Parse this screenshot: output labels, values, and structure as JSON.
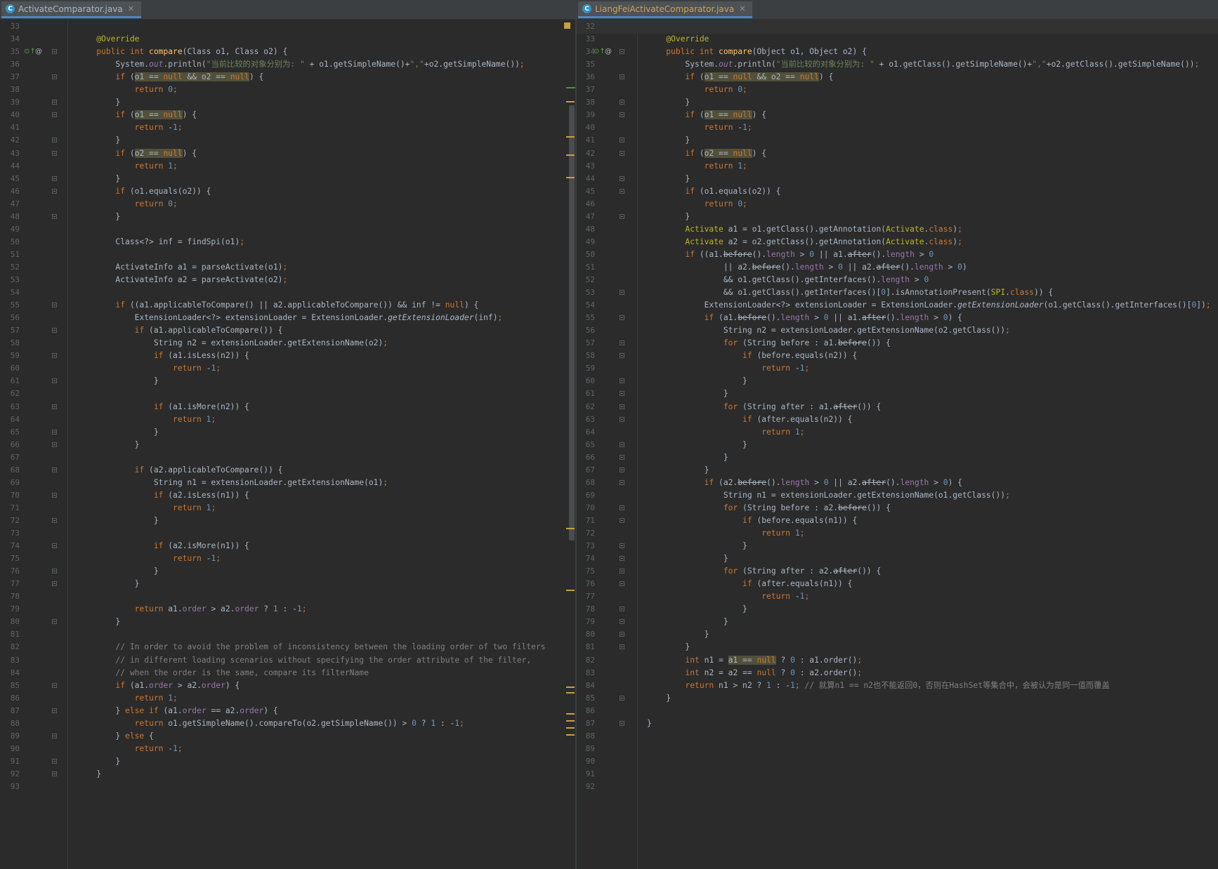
{
  "left": {
    "tab_title": "ActivateComparator.java",
    "tab_icon_letter": "C",
    "lines": [
      {
        "no": "33",
        "code": ""
      },
      {
        "no": "34",
        "code": "    <span class=\"a\">@Override</span>"
      },
      {
        "no": "35",
        "code": "    <span class=\"k\">public int </span><span class=\"f\">compare</span>(Class o1, Class o2) {",
        "gutter": "impl"
      },
      {
        "no": "36",
        "code": "        System.<span class=\"st\">out</span>.println(<span class=\"s\">\"当前比较的对象分别为: \"</span> + o1.getSimpleName()+<span class=\"s\">\",\"</span>+o2.getSimpleName())<span class=\"k\">;</span>"
      },
      {
        "no": "37",
        "code": "        <span class=\"k\">if </span>(<span class=\"hv\">o1 == <span class=\"k\">null</span> &amp;&amp; o2 == <span class=\"k\">null</span></span>) {"
      },
      {
        "no": "38",
        "code": "            <span class=\"k\">return </span><span class=\"n\">0</span><span class=\"k\">;</span>"
      },
      {
        "no": "39",
        "code": "        }"
      },
      {
        "no": "40",
        "code": "        <span class=\"k\">if </span>(<span class=\"hv\">o1 == <span class=\"k\">null</span></span>) {"
      },
      {
        "no": "41",
        "code": "            <span class=\"k\">return </span>-<span class=\"n\">1</span><span class=\"k\">;</span>"
      },
      {
        "no": "42",
        "code": "        }"
      },
      {
        "no": "43",
        "code": "        <span class=\"k\">if </span>(<span class=\"hv\">o2 == <span class=\"k\">null</span></span>) {"
      },
      {
        "no": "44",
        "code": "            <span class=\"k\">return </span><span class=\"n\">1</span><span class=\"k\">;</span>"
      },
      {
        "no": "45",
        "code": "        }"
      },
      {
        "no": "46",
        "code": "        <span class=\"k\">if </span>(o1.equals(o2)) {"
      },
      {
        "no": "47",
        "code": "            <span class=\"k\">return </span><span class=\"n\">0</span><span class=\"k\">;</span>"
      },
      {
        "no": "48",
        "code": "        }"
      },
      {
        "no": "49",
        "code": ""
      },
      {
        "no": "50",
        "code": "        Class&lt;?&gt; inf = findSpi(o1)<span class=\"k\">;</span>"
      },
      {
        "no": "51",
        "code": ""
      },
      {
        "no": "52",
        "code": "        ActivateInfo a1 = parseActivate(o1)<span class=\"k\">;</span>"
      },
      {
        "no": "53",
        "code": "        ActivateInfo a2 = parseActivate(o2)<span class=\"k\">;</span>"
      },
      {
        "no": "54",
        "code": ""
      },
      {
        "no": "55",
        "code": "        <span class=\"k\">if </span>((a1.applicableToCompare() || a2.applicableToCompare()) &amp;&amp; inf != <span class=\"k\">null</span>) {"
      },
      {
        "no": "56",
        "code": "            ExtensionLoader&lt;?&gt; extensionLoader = ExtensionLoader.<span class=\"i\">getExtensionLoader</span>(inf)<span class=\"k\">;</span>"
      },
      {
        "no": "57",
        "code": "            <span class=\"k\">if </span>(a1.applicableToCompare()) {"
      },
      {
        "no": "58",
        "code": "                String n2 = extensionLoader.getExtensionName(o2)<span class=\"k\">;</span>"
      },
      {
        "no": "59",
        "code": "                <span class=\"k\">if </span>(a1.isLess(n2)) {"
      },
      {
        "no": "60",
        "code": "                    <span class=\"k\">return </span>-<span class=\"n\">1</span><span class=\"k\">;</span>"
      },
      {
        "no": "61",
        "code": "                }"
      },
      {
        "no": "62",
        "code": ""
      },
      {
        "no": "63",
        "code": "                <span class=\"k\">if </span>(a1.isMore(n2)) {"
      },
      {
        "no": "64",
        "code": "                    <span class=\"k\">return </span><span class=\"n\">1</span><span class=\"k\">;</span>"
      },
      {
        "no": "65",
        "code": "                }"
      },
      {
        "no": "66",
        "code": "            }"
      },
      {
        "no": "67",
        "code": ""
      },
      {
        "no": "68",
        "code": "            <span class=\"k\">if </span>(a2.applicableToCompare()) {"
      },
      {
        "no": "69",
        "code": "                String n1 = extensionLoader.getExtensionName(o1)<span class=\"k\">;</span>"
      },
      {
        "no": "70",
        "code": "                <span class=\"k\">if </span>(a2.isLess(n1)) {"
      },
      {
        "no": "71",
        "code": "                    <span class=\"k\">return </span><span class=\"n\">1</span><span class=\"k\">;</span>"
      },
      {
        "no": "72",
        "code": "                }"
      },
      {
        "no": "73",
        "code": ""
      },
      {
        "no": "74",
        "code": "                <span class=\"k\">if </span>(a2.isMore(n1)) {"
      },
      {
        "no": "75",
        "code": "                    <span class=\"k\">return </span>-<span class=\"n\">1</span><span class=\"k\">;</span>"
      },
      {
        "no": "76",
        "code": "                }"
      },
      {
        "no": "77",
        "code": "            }"
      },
      {
        "no": "78",
        "code": ""
      },
      {
        "no": "79",
        "code": "            <span class=\"k\">return </span>a1.<span class=\"fd\">order</span> &gt; a2.<span class=\"fd\">order</span> ? <span class=\"n\">1</span> : -<span class=\"n\">1</span><span class=\"k\">;</span>"
      },
      {
        "no": "80",
        "code": "        }"
      },
      {
        "no": "81",
        "code": ""
      },
      {
        "no": "82",
        "code": "        <span class=\"c\">// In order to avoid the problem of inconsistency between the loading order of two filters</span>"
      },
      {
        "no": "83",
        "code": "        <span class=\"c\">// in different loading scenarios without specifying the order attribute of the filter,</span>"
      },
      {
        "no": "84",
        "code": "        <span class=\"c\">// when the order is the same, compare its filterName</span>"
      },
      {
        "no": "85",
        "code": "        <span class=\"k\">if </span>(a1.<span class=\"fd\">order</span> &gt; a2.<span class=\"fd\">order</span>) {"
      },
      {
        "no": "86",
        "code": "            <span class=\"k\">return </span><span class=\"n\">1</span><span class=\"k\">;</span>"
      },
      {
        "no": "87",
        "code": "        } <span class=\"k\">else if </span>(a1.<span class=\"fd\">order</span> == a2.<span class=\"fd\">order</span>) {"
      },
      {
        "no": "88",
        "code": "            <span class=\"k\">return </span>o1.getSimpleName().compareTo(o2.getSimpleName()) &gt; <span class=\"n\">0</span> ? <span class=\"n\">1</span> : -<span class=\"n\">1</span><span class=\"k\">;</span>"
      },
      {
        "no": "89",
        "code": "        } <span class=\"k\">else </span>{"
      },
      {
        "no": "90",
        "code": "            <span class=\"k\">return </span>-<span class=\"n\">1</span><span class=\"k\">;</span>"
      },
      {
        "no": "91",
        "code": "        }"
      },
      {
        "no": "92",
        "code": "    }"
      },
      {
        "no": "93",
        "code": ""
      }
    ]
  },
  "right": {
    "tab_title": "LiangFeiActivateComparator.java",
    "tab_icon_letter": "C",
    "lines": [
      {
        "no": "32",
        "code": ""
      },
      {
        "no": "33",
        "code": "    <span class=\"a\">@Override</span>"
      },
      {
        "no": "34",
        "code": "    <span class=\"k\">public int </span><span class=\"f\">compare</span>(Object o1, Object o2) {",
        "gutter": "impl"
      },
      {
        "no": "35",
        "code": "        System.<span class=\"st\">out</span>.println(<span class=\"s\">\"当前比较的对象分别为: \"</span> + o1.getClass().getSimpleName()+<span class=\"s\">\",\"</span>+o2.getClass().getSimpleName())<span class=\"k\">;</span>"
      },
      {
        "no": "36",
        "code": "        <span class=\"k\">if </span>(<span class=\"hv\">o1 == <span class=\"k\">null</span> &amp;&amp; o2 == <span class=\"k\">null</span></span>) {"
      },
      {
        "no": "37",
        "code": "            <span class=\"k\">return </span><span class=\"n\">0</span><span class=\"k\">;</span>"
      },
      {
        "no": "38",
        "code": "        }"
      },
      {
        "no": "39",
        "code": "        <span class=\"k\">if </span>(<span class=\"hv\">o1 == <span class=\"k\">null</span></span>) {"
      },
      {
        "no": "40",
        "code": "            <span class=\"k\">return </span>-<span class=\"n\">1</span><span class=\"k\">;</span>"
      },
      {
        "no": "41",
        "code": "        }"
      },
      {
        "no": "42",
        "code": "        <span class=\"k\">if </span>(<span class=\"hv\">o2 == <span class=\"k\">null</span></span>) {"
      },
      {
        "no": "43",
        "code": "            <span class=\"k\">return </span><span class=\"n\">1</span><span class=\"k\">;</span>"
      },
      {
        "no": "44",
        "code": "        }"
      },
      {
        "no": "45",
        "code": "        <span class=\"k\">if </span>(o1.equals(o2)) {"
      },
      {
        "no": "46",
        "code": "            <span class=\"k\">return </span><span class=\"n\">0</span><span class=\"k\">;</span>"
      },
      {
        "no": "47",
        "code": "        }"
      },
      {
        "no": "48",
        "code": "        <span class=\"a\">Activate</span> a1 = o1.getClass().getAnnotation(<span class=\"a\">Activate</span>.<span class=\"k\">class</span>)<span class=\"k\">;</span>"
      },
      {
        "no": "49",
        "code": "        <span class=\"a\">Activate</span> a2 = o2.getClass().getAnnotation(<span class=\"a\">Activate</span>.<span class=\"k\">class</span>)<span class=\"k\">;</span>"
      },
      {
        "no": "50",
        "code": "        <span class=\"k\">if </span>((a1.<span class=\"x\">before</span>().<span class=\"fd\">length</span> &gt; <span class=\"n\">0</span> || a1.<span class=\"x\">after</span>().<span class=\"fd\">length</span> &gt; <span class=\"n\">0</span>"
      },
      {
        "no": "51",
        "code": "                || a2.<span class=\"x\">before</span>().<span class=\"fd\">length</span> &gt; <span class=\"n\">0</span> || a2.<span class=\"x\">after</span>().<span class=\"fd\">length</span> &gt; <span class=\"n\">0</span>)"
      },
      {
        "no": "52",
        "code": "                &amp;&amp; o1.getClass().getInterfaces().<span class=\"fd\">length</span> &gt; <span class=\"n\">0</span>"
      },
      {
        "no": "53",
        "code": "                &amp;&amp; o1.getClass().getInterfaces()[<span class=\"n\">0</span>].isAnnotationPresent(<span class=\"a\">SPI</span>.<span class=\"k\">class</span>)) {"
      },
      {
        "no": "54",
        "code": "            ExtensionLoader&lt;?&gt; extensionLoader = ExtensionLoader.<span class=\"i\">getExtensionLoader</span>(o1.getClass().getInterfaces()[<span class=\"n\">0</span>])<span class=\"k\">;</span>"
      },
      {
        "no": "55",
        "code": "            <span class=\"k\">if </span>(a1.<span class=\"x\">before</span>().<span class=\"fd\">length</span> &gt; <span class=\"n\">0</span> || a1.<span class=\"x\">after</span>().<span class=\"fd\">length</span> &gt; <span class=\"n\">0</span>) {"
      },
      {
        "no": "56",
        "code": "                String n2 = extensionLoader.getExtensionName(o2.getClass())<span class=\"k\">;</span>"
      },
      {
        "no": "57",
        "code": "                <span class=\"k\">for </span>(String before : a1.<span class=\"x\">before</span>()) {"
      },
      {
        "no": "58",
        "code": "                    <span class=\"k\">if </span>(before.equals(n2)) {"
      },
      {
        "no": "59",
        "code": "                        <span class=\"k\">return </span>-<span class=\"n\">1</span><span class=\"k\">;</span>"
      },
      {
        "no": "60",
        "code": "                    }"
      },
      {
        "no": "61",
        "code": "                }"
      },
      {
        "no": "62",
        "code": "                <span class=\"k\">for </span>(String after : a1.<span class=\"x\">after</span>()) {"
      },
      {
        "no": "63",
        "code": "                    <span class=\"k\">if </span>(after.equals(n2)) {"
      },
      {
        "no": "64",
        "code": "                        <span class=\"k\">return </span><span class=\"n\">1</span><span class=\"k\">;</span>"
      },
      {
        "no": "65",
        "code": "                    }"
      },
      {
        "no": "66",
        "code": "                }"
      },
      {
        "no": "67",
        "code": "            }"
      },
      {
        "no": "68",
        "code": "            <span class=\"k\">if </span>(a2.<span class=\"x\">before</span>().<span class=\"fd\">length</span> &gt; <span class=\"n\">0</span> || a2.<span class=\"x\">after</span>().<span class=\"fd\">length</span> &gt; <span class=\"n\">0</span>) {"
      },
      {
        "no": "69",
        "code": "                String n1 = extensionLoader.getExtensionName(o1.getClass())<span class=\"k\">;</span>"
      },
      {
        "no": "70",
        "code": "                <span class=\"k\">for </span>(String before : a2.<span class=\"x\">before</span>()) {"
      },
      {
        "no": "71",
        "code": "                    <span class=\"k\">if </span>(before.equals(n1)) {"
      },
      {
        "no": "72",
        "code": "                        <span class=\"k\">return </span><span class=\"n\">1</span><span class=\"k\">;</span>"
      },
      {
        "no": "73",
        "code": "                    }"
      },
      {
        "no": "74",
        "code": "                }"
      },
      {
        "no": "75",
        "code": "                <span class=\"k\">for </span>(String after : a2.<span class=\"x\">after</span>()) {"
      },
      {
        "no": "76",
        "code": "                    <span class=\"k\">if </span>(after.equals(n1)) {"
      },
      {
        "no": "77",
        "code": "                        <span class=\"k\">return </span>-<span class=\"n\">1</span><span class=\"k\">;</span>"
      },
      {
        "no": "78",
        "code": "                    }"
      },
      {
        "no": "79",
        "code": "                }"
      },
      {
        "no": "80",
        "code": "            }"
      },
      {
        "no": "81",
        "code": "        }"
      },
      {
        "no": "82",
        "code": "        <span class=\"k\">int </span>n1 = <span class=\"hv\">a1 == <span class=\"k\">null</span></span> ? <span class=\"n\">0</span> : a1.order()<span class=\"k\">;</span>"
      },
      {
        "no": "83",
        "code": "        <span class=\"k\">int </span>n2 = a2 == <span class=\"k\">null</span> ? <span class=\"n\">0</span> : a2.order()<span class=\"k\">;</span>"
      },
      {
        "no": "84",
        "code": "        <span class=\"k\">return </span>n1 &gt; n2 ? <span class=\"n\">1</span> : -<span class=\"n\">1</span><span class=\"k\">;</span> <span class=\"c\">// 就算n1 == n2也不能返回0，否则在HashSet等集合中，会被认为是同一值而覆盖</span>"
      },
      {
        "no": "85",
        "code": "    }"
      },
      {
        "no": "86",
        "code": ""
      },
      {
        "no": "87",
        "code": "}"
      },
      {
        "no": "88",
        "code": ""
      },
      {
        "no": "89",
        "code": ""
      },
      {
        "no": "90",
        "code": ""
      },
      {
        "no": "91",
        "code": ""
      },
      {
        "no": "92",
        "code": ""
      }
    ]
  },
  "icons": {
    "tab_close": "close-icon",
    "override": "override-gutter-icon",
    "annotation": "annotation-gutter-icon"
  },
  "colors": {
    "background": "#2b2b2b",
    "keyword": "#cc7832",
    "string": "#6a8759",
    "number": "#6897bb",
    "comment": "#808080",
    "annotation": "#bbb529",
    "method": "#ffc66d",
    "field": "#9876aa",
    "line_number": "#606366",
    "tab_underline": "#4a88c7"
  }
}
